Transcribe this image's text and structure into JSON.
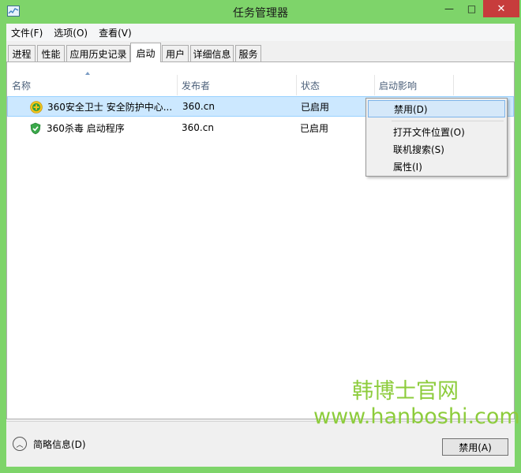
{
  "window": {
    "title": "任务管理器",
    "minimize_glyph": "—",
    "maximize_glyph": "□",
    "close_glyph": "✕",
    "title_color": "#7ed46a"
  },
  "menubar": [
    {
      "label": "文件(F)"
    },
    {
      "label": "选项(O)"
    },
    {
      "label": "查看(V)"
    }
  ],
  "tabs": [
    {
      "label": "进程",
      "active": false
    },
    {
      "label": "性能",
      "active": false
    },
    {
      "label": "应用历史记录",
      "active": false
    },
    {
      "label": "启动",
      "active": true
    },
    {
      "label": "用户",
      "active": false
    },
    {
      "label": "详细信息",
      "active": false
    },
    {
      "label": "服务",
      "active": false
    }
  ],
  "table": {
    "columns": [
      "名称",
      "发布者",
      "状态",
      "启动影响"
    ],
    "rows": [
      {
        "name": "360安全卫士 安全防护中心...",
        "publisher": "360.cn",
        "status": "已启用",
        "impact": "",
        "icon": "360-safeguard-icon",
        "selected": true
      },
      {
        "name": "360杀毒 启动程序",
        "publisher": "360.cn",
        "status": "已启用",
        "impact": "",
        "icon": "360-antivirus-shield-icon",
        "selected": false
      }
    ]
  },
  "context_menu": {
    "items": [
      {
        "label": "禁用(D)",
        "hover": true
      },
      {
        "label": "打开文件位置(O)",
        "hover": false
      },
      {
        "label": "联机搜索(S)",
        "hover": false
      },
      {
        "label": "属性(I)",
        "hover": false
      }
    ]
  },
  "watermark": {
    "line1": "韩博士官网",
    "line2": "www.hanboshi.com",
    "color": "#8dcc3c"
  },
  "footer": {
    "less_details": "简略信息(D)",
    "less_details_glyph": "︿",
    "disable_button": "禁用(A)"
  }
}
